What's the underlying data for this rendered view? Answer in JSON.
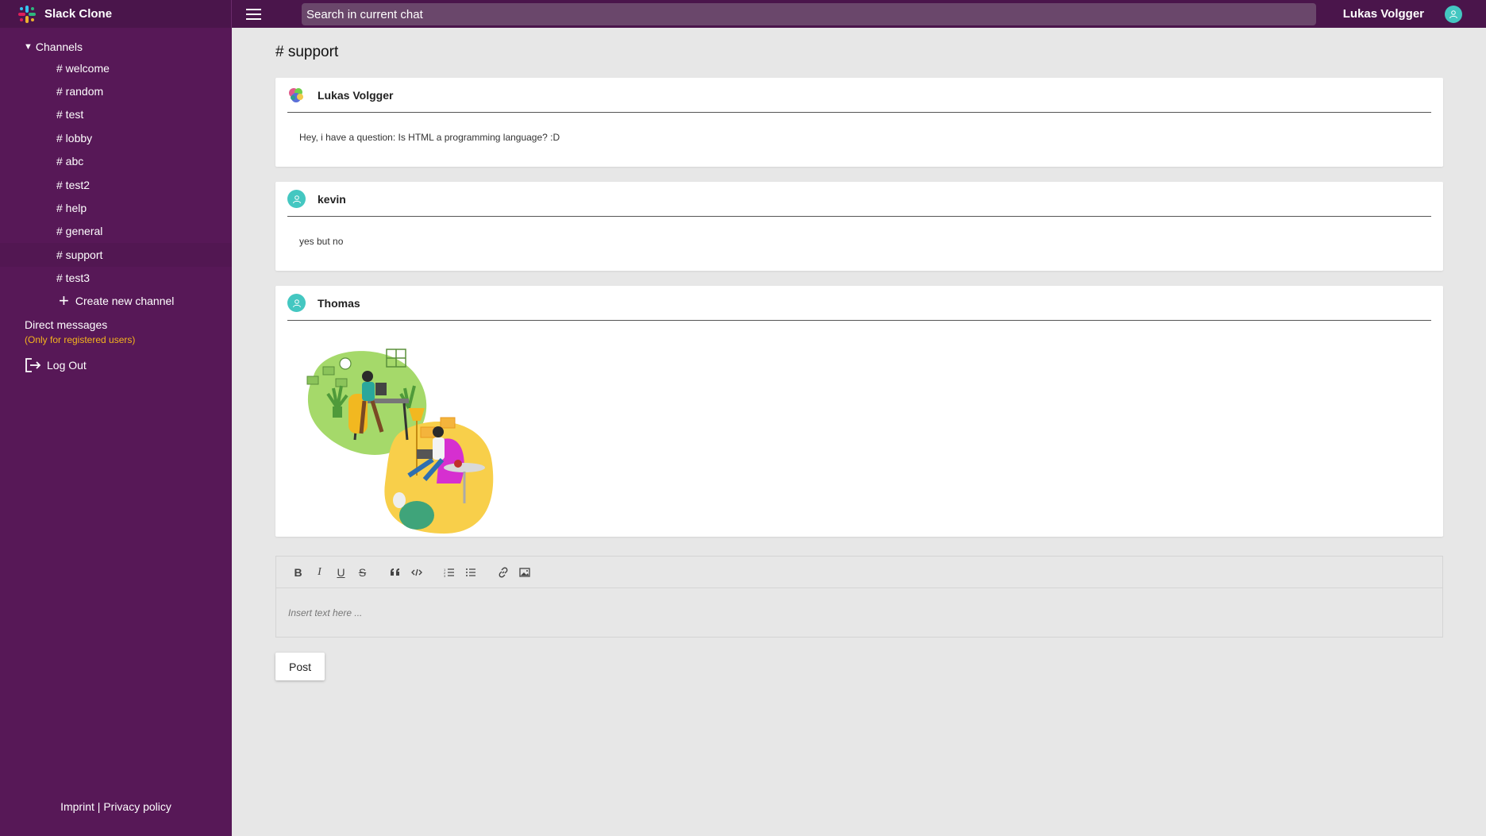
{
  "app": {
    "name": "Slack Clone"
  },
  "header": {
    "search_placeholder": "Search in current chat",
    "user_name": "Lukas Volgger"
  },
  "sidebar": {
    "channels_label": "Channels",
    "channels": [
      "# welcome",
      "# random",
      "# test",
      "# lobby",
      "# abc",
      "# test2",
      "# help",
      "# general",
      "# support",
      "# test3"
    ],
    "active_channel": "# support",
    "create_channel": "Create new channel",
    "direct_messages": "Direct messages",
    "dm_note": "(Only for registered users)",
    "logout": "Log Out",
    "footer": {
      "imprint": "Imprint",
      "separator": "|",
      "privacy": "Privacy policy"
    }
  },
  "main": {
    "channel_title": "# support",
    "messages": [
      {
        "author": "Lukas Volgger",
        "text": "Hey, i have a question: Is HTML a programming language? :D",
        "avatar": "colorful-avatar-icon"
      },
      {
        "author": "kevin",
        "text": "yes but no",
        "avatar": "user-icon"
      },
      {
        "author": "Thomas",
        "text": "",
        "avatar": "user-icon",
        "image": "remote-work-illustration"
      }
    ],
    "editor": {
      "placeholder": "Insert text here ...",
      "toolbar": [
        "bold-icon",
        "italic-icon",
        "underline-icon",
        "strike-icon",
        "quote-icon",
        "code-icon",
        "ordered-list-icon",
        "bullet-list-icon",
        "link-icon",
        "image-icon"
      ],
      "bold": "B",
      "italic": "I",
      "underline": "U",
      "strike": "S"
    },
    "post_button": "Post"
  },
  "colors": {
    "brand": "#4a154b",
    "sidebar": "#571857",
    "accent": "#44c7c1",
    "note": "#f5b51d"
  }
}
